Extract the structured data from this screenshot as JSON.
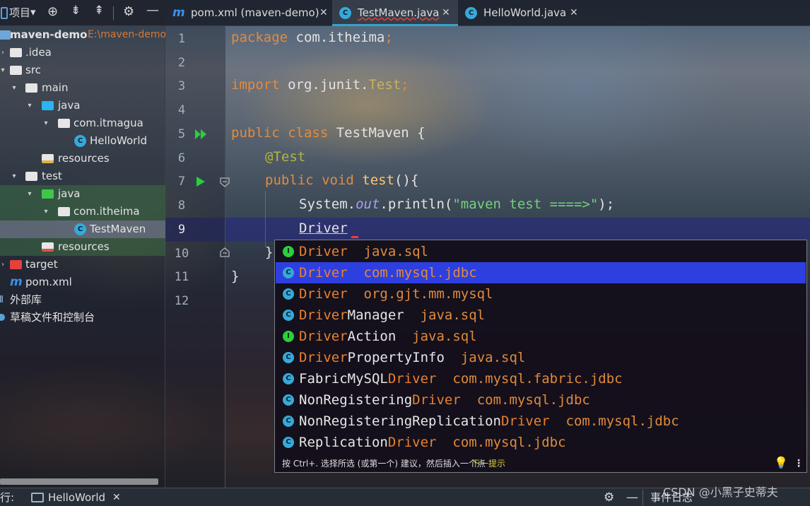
{
  "project_toolbar": {
    "title": "项目",
    "dropdown": "▾",
    "icons": [
      "target-icon",
      "expand-all-icon",
      "collapse-all-icon",
      "gear-icon",
      "minimize-icon"
    ]
  },
  "tree": [
    {
      "label": "maven-demo",
      "path": "E:\\maven-demo",
      "icon": "module-folder-icon"
    },
    {
      "label": ".idea",
      "icon": "folder-icon"
    },
    {
      "label": "src",
      "icon": "folder-icon"
    },
    {
      "label": "main",
      "icon": "folder-icon"
    },
    {
      "label": "java",
      "icon": "source-folder-icon"
    },
    {
      "label": "com.itmagua",
      "icon": "package-icon"
    },
    {
      "label": "HelloWorld",
      "icon": "java-class-icon"
    },
    {
      "label": "resources",
      "icon": "resources-folder-icon"
    },
    {
      "label": "test",
      "icon": "folder-icon"
    },
    {
      "label": "java",
      "icon": "test-source-folder-icon"
    },
    {
      "label": "com.itheima",
      "icon": "package-icon"
    },
    {
      "label": "TestMaven",
      "icon": "java-class-icon"
    },
    {
      "label": "resources",
      "icon": "test-resources-folder-icon"
    },
    {
      "label": "target",
      "icon": "excluded-folder-icon"
    },
    {
      "label": "pom.xml",
      "icon": "maven-icon"
    },
    {
      "label": "外部库",
      "icon": "library-icon"
    },
    {
      "label": "草稿文件和控制台",
      "icon": "scratch-icon"
    }
  ],
  "tabs": [
    {
      "label": "pom.xml (maven-demo)",
      "icon": "maven-icon",
      "close": "✕"
    },
    {
      "label": "TestMaven.java",
      "icon": "java-class-icon",
      "close": "✕",
      "active": true
    },
    {
      "label": "HelloWorld.java",
      "icon": "java-class-icon",
      "close": "✕"
    }
  ],
  "editor": {
    "line_numbers": [
      "1",
      "2",
      "3",
      "4",
      "5",
      "6",
      "7",
      "8",
      "9",
      "10",
      "11",
      "12"
    ],
    "code": {
      "l1_kw": "package",
      "l1_rest": " com.itheima",
      "l1_semi": ";",
      "l3_kw": "import",
      "l3_rest": " org.junit.",
      "l3_type": "Test",
      "l3_semi": ";",
      "l5_kw": "public class",
      "l5_rest": " TestMaven {",
      "l6_ann": "@Test",
      "l7_kw": "public void",
      "l7_fn": "test",
      "l7_rest": "(){",
      "l8_a": "System.",
      "l8_fld": "out",
      "l8_b": ".println(",
      "l8_str": "\"maven test ====>\"",
      "l8_c": ");",
      "l9": "Driver",
      "l10": "}",
      "l11": "}"
    }
  },
  "completion": {
    "items": [
      {
        "icon": "I",
        "match": "Driver",
        "rest": "",
        "pkg": "java.sql"
      },
      {
        "icon": "C",
        "match": "Driver",
        "rest": "",
        "pkg": "com.mysql.jdbc",
        "selected": true
      },
      {
        "icon": "C",
        "match": "Driver",
        "rest": "",
        "pkg": "org.gjt.mm.mysql"
      },
      {
        "icon": "C",
        "match": "Driver",
        "rest": "Manager",
        "pkg": "java.sql"
      },
      {
        "icon": "I",
        "match": "Driver",
        "rest": "Action",
        "pkg": "java.sql"
      },
      {
        "icon": "C",
        "match": "Driver",
        "rest": "PropertyInfo",
        "pkg": "java.sql"
      },
      {
        "icon": "C",
        "pre": "FabricMySQL",
        "match": "Driver",
        "rest": "",
        "pkg": "com.mysql.fabric.jdbc"
      },
      {
        "icon": "C",
        "pre": "NonRegistering",
        "match": "Driver",
        "rest": "",
        "pkg": "com.mysql.jdbc"
      },
      {
        "icon": "C",
        "pre": "NonRegisteringReplication",
        "match": "Driver",
        "rest": "",
        "pkg": "com.mysql.jdbc"
      },
      {
        "icon": "C",
        "pre": "Replication",
        "match": "Driver",
        "rest": "",
        "pkg": "com.mysql.jdbc"
      }
    ],
    "footer_hint": "按 Ctrl+. 选择所选 (或第一个) 建议，然后插入一个点",
    "footer_link": "下一提示"
  },
  "bottom": {
    "run_label": "行:",
    "run_tab": "HelloWorld",
    "close": "✕",
    "event_log": "事件日志",
    "watermark": "CSDN @小黑子史蒂夫"
  },
  "colors": {
    "keyword": "#e38b3d",
    "annotation": "#b5b53e",
    "string": "#75d17a",
    "selection": "#2e3fe0",
    "caret_line": "#282c78"
  }
}
